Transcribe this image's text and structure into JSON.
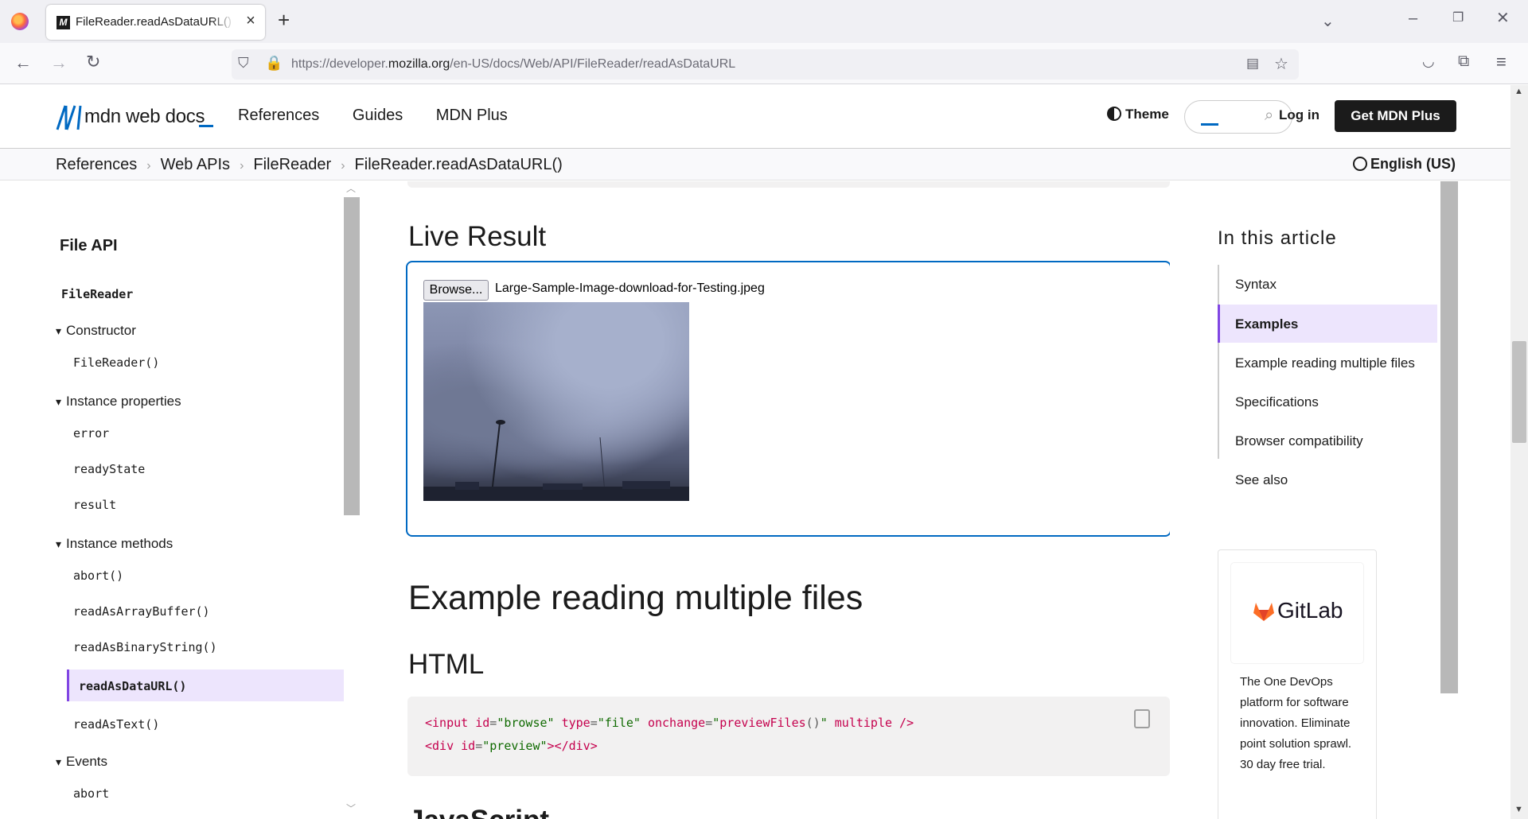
{
  "browser": {
    "tab_title": "FileReader.readAsDataURL() - Web APIs | MDN",
    "tab_favicon": "M",
    "url_prefix": "https://developer.",
    "url_domain": "mozilla.org",
    "url_path": "/en-US/docs/Web/API/FileReader/readAsDataURL"
  },
  "header": {
    "logo_text": "mdn web docs",
    "nav": [
      "References",
      "Guides",
      "MDN Plus"
    ],
    "theme_label": "Theme",
    "login_label": "Log in",
    "cta_label": "Get MDN Plus"
  },
  "breadcrumb": {
    "items": [
      "References",
      "Web APIs",
      "FileReader",
      "FileReader.readAsDataURL()"
    ],
    "language": "English (US)"
  },
  "sidebar": {
    "title": "File API",
    "items": [
      {
        "label": "FileReader",
        "kind": "head"
      },
      {
        "label": "Constructor",
        "kind": "group"
      },
      {
        "label": "FileReader()",
        "kind": "link"
      },
      {
        "label": "Instance properties",
        "kind": "group"
      },
      {
        "label": "error",
        "kind": "link"
      },
      {
        "label": "readyState",
        "kind": "link"
      },
      {
        "label": "result",
        "kind": "link"
      },
      {
        "label": "Instance methods",
        "kind": "group"
      },
      {
        "label": "abort()",
        "kind": "link"
      },
      {
        "label": "readAsArrayBuffer()",
        "kind": "link"
      },
      {
        "label": "readAsBinaryString()",
        "kind": "link"
      },
      {
        "label": "readAsDataURL()",
        "kind": "active"
      },
      {
        "label": "readAsText()",
        "kind": "link"
      },
      {
        "label": "Events",
        "kind": "group"
      },
      {
        "label": "abort",
        "kind": "link"
      }
    ]
  },
  "main": {
    "live_heading": "Live Result",
    "browse_label": "Browse...",
    "file_name": "Large-Sample-Image-download-for-Testing.jpeg",
    "multi_heading": "Example reading multiple files",
    "html_heading": "HTML",
    "code": {
      "line1": {
        "t1": "<input",
        "a1": " id",
        "e1": "=",
        "s1": "\"browse\"",
        "a2": " type",
        "e2": "=",
        "s2": "\"file\"",
        "a3": " onchange",
        "e3": "=",
        "s3": "\"",
        "f3": "previewFiles",
        "p3": "()",
        "s3b": "\"",
        "a4": " multiple",
        "t2": " />"
      },
      "line2": {
        "t1": "<div",
        "a1": " id",
        "e1": "=",
        "s1": "\"preview\"",
        "t2": "></div>"
      }
    },
    "js_heading": "JavaScript"
  },
  "toc": {
    "title": "In this article",
    "items": [
      "Syntax",
      "Examples",
      "Example reading multiple files",
      "Specifications",
      "Browser compatibility",
      "See also"
    ],
    "active_index": 1
  },
  "ad": {
    "brand": "GitLab",
    "text": "The One DevOps platform for software innovation. Eliminate point solution sprawl. 30 day free trial."
  },
  "colors": {
    "accent": "#0069c2",
    "active_bg": "#ede5fd",
    "active_border": "#8146e3"
  }
}
